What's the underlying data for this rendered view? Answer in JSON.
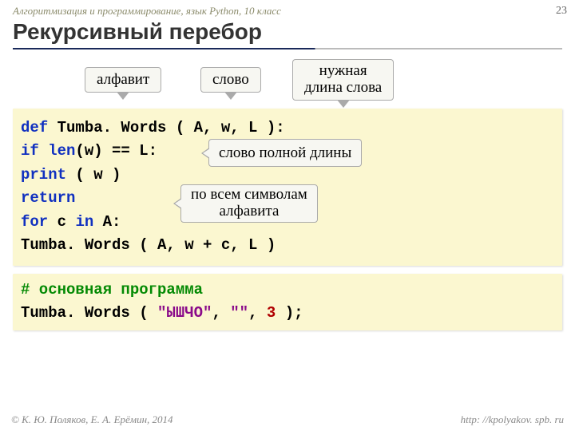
{
  "header": {
    "breadcrumb": "Алгоритмизация и программирование, язык Python, 10 класс",
    "page_number": "23",
    "title": "Рекурсивный перебор"
  },
  "labels": {
    "alphabet": "алфавит",
    "word": "слово",
    "needed_len_l1": "нужная",
    "needed_len_l2": "длина слова"
  },
  "code1": {
    "l1_kw": "def",
    "l1_rest": " Tumba. Words ( A, w, L ):",
    "l2a": "  if",
    "l2b": " len",
    "l2c": "(w) == L:",
    "l3a": "    print",
    "l3b": " ( w )",
    "l4": "    return",
    "l5a": "  for",
    "l5b": " c ",
    "l5c": "in",
    "l5d": " A:",
    "l6": "    Tumba. Words ( A, w + c, L )"
  },
  "annot": {
    "full_len": "слово полной длины",
    "all_syms_l1": "по всем символам",
    "all_syms_l2": "алфавита"
  },
  "code2": {
    "comment": "# основная программа",
    "call_a": "Tumba. Words ( ",
    "str": "\"ЫШЧО\"",
    "call_b": ", ",
    "str2": "\"\"",
    "call_c": ", ",
    "num": "3",
    "call_d": " );"
  },
  "footer": {
    "left": "© К. Ю. Поляков, Е. А. Ерёмин, 2014",
    "right": "http: //kpolyakov. spb. ru"
  }
}
